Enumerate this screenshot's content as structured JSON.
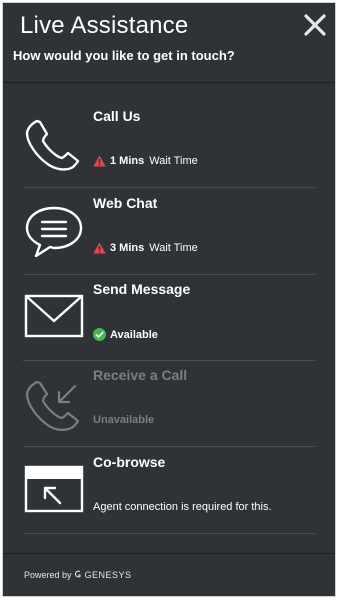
{
  "header": {
    "title": "Live Assistance",
    "subtitle": "How would you like to get in touch?"
  },
  "options": [
    {
      "label": "Call Us",
      "status_strong": "1 Mins",
      "status_text": "Wait Time",
      "icon": "phone-icon",
      "status_icon": "warning-icon"
    },
    {
      "label": "Web Chat",
      "status_strong": "3 Mins",
      "status_text": "Wait Time",
      "icon": "chat-bubble-icon",
      "status_icon": "warning-icon"
    },
    {
      "label": "Send Message",
      "status_strong": "Available",
      "status_text": "",
      "icon": "envelope-icon",
      "status_icon": "check-circle-icon"
    },
    {
      "label": "Receive a Call",
      "status_text": "Unavailable",
      "icon": "phone-incoming-icon",
      "disabled": true
    },
    {
      "label": "Co-browse",
      "status_text": "Agent connection is required for this.",
      "icon": "cobrowse-window-icon"
    }
  ],
  "footer": {
    "powered_by": "Powered by",
    "brand": "GENESYS"
  },
  "colors": {
    "panel_bg": "#2f3236",
    "warning": "#e0484f",
    "available": "#3fb950",
    "disabled": "#7b7f84"
  }
}
